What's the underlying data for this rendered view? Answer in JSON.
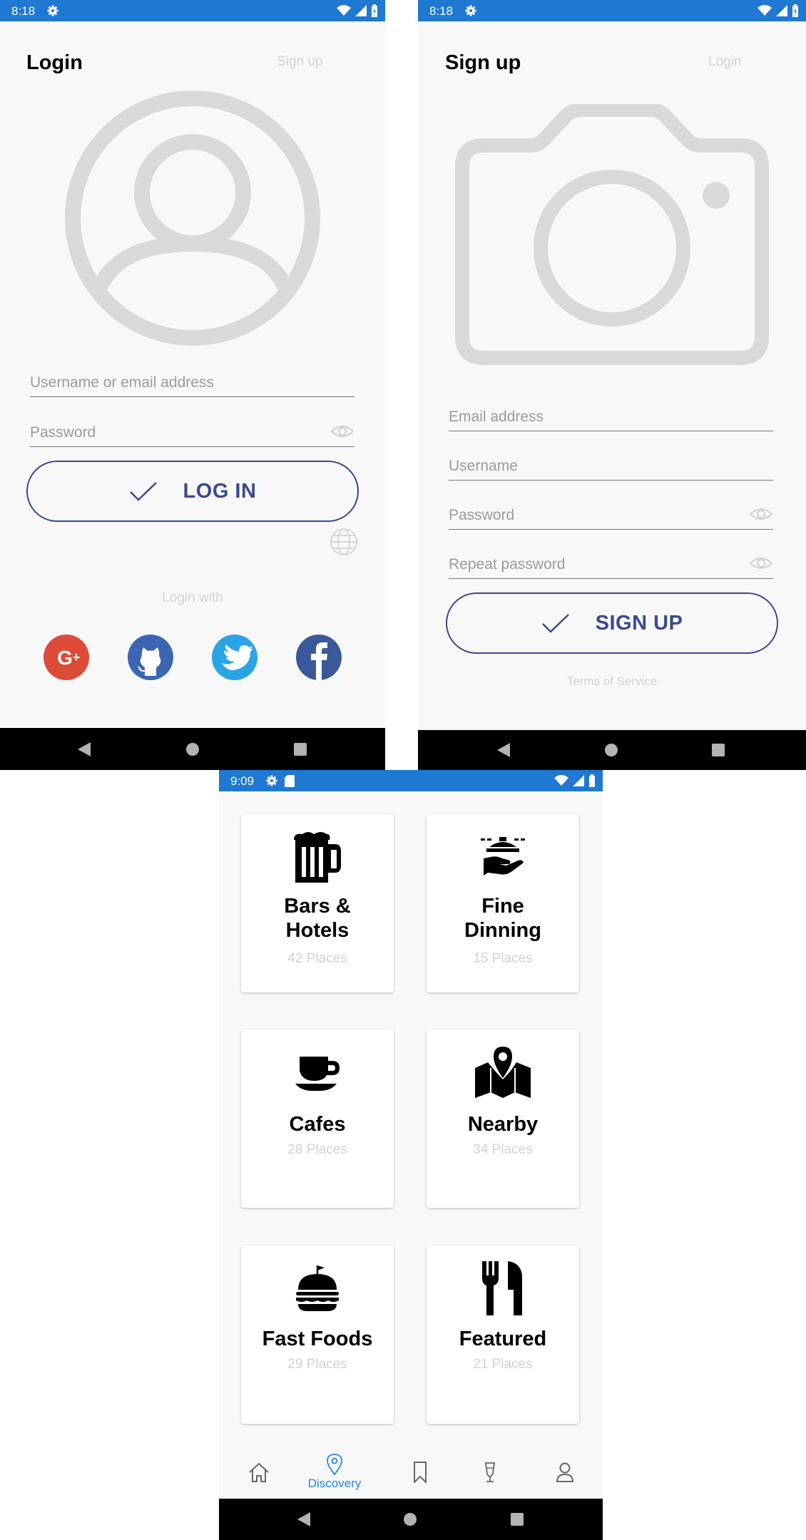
{
  "login_screen": {
    "status_time": "8:18",
    "title": "Login",
    "signup_link": "Sign up",
    "username_placeholder": "Username or email address",
    "password_placeholder": "Password",
    "login_button": "LOG IN",
    "login_with": "Login with",
    "social": [
      "google-plus",
      "github",
      "twitter",
      "facebook"
    ]
  },
  "signup_screen": {
    "status_time": "8:18",
    "title": "Sign up",
    "login_link": "Login",
    "email_placeholder": "Email address",
    "username_placeholder": "Username",
    "password_placeholder": "Password",
    "repeat_password_placeholder": "Repeat password",
    "signup_button": "SIGN UP",
    "terms": "Terms of Service"
  },
  "discovery_screen": {
    "status_time": "9:09",
    "categories": [
      {
        "title_line1": "Bars &",
        "title_line2": "Hotels",
        "count": "42 Places",
        "icon": "beer-mug"
      },
      {
        "title_line1": "Fine",
        "title_line2": "Dinning",
        "count": "15 Places",
        "icon": "waiter-tray"
      },
      {
        "title_line1": "Cafes",
        "title_line2": "",
        "count": "28 Places",
        "icon": "coffee-cup"
      },
      {
        "title_line1": "Nearby",
        "title_line2": "",
        "count": "34 Places",
        "icon": "map-pin"
      },
      {
        "title_line1": "Fast Foods",
        "title_line2": "",
        "count": "29 Places",
        "icon": "burger"
      },
      {
        "title_line1": "Featured",
        "title_line2": "",
        "count": "21 Places",
        "icon": "fork-knife"
      }
    ],
    "tabs": {
      "home": "",
      "discovery": "Discovery",
      "bookmarks": "",
      "drinks": "",
      "profile": ""
    }
  },
  "colors": {
    "status_bar": "#1f78d1",
    "accent_button": "#3a4a8e",
    "google": "#dd4b39",
    "github": "#3b66b3",
    "twitter": "#2ba4e6",
    "facebook": "#3b5998",
    "tab_active": "#1e88e5"
  }
}
